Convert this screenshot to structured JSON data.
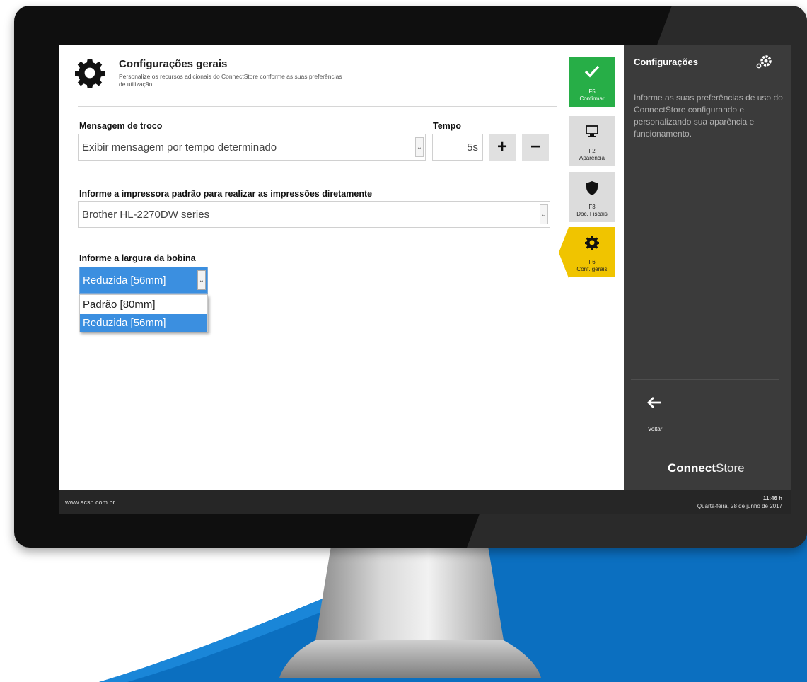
{
  "header": {
    "title": "Configurações gerais",
    "subtitle": "Personalize os recursos adicionais do ConnectStore conforme as suas preferências de utilização."
  },
  "troco": {
    "label": "Mensagem de troco",
    "value": "Exibir mensagem por tempo determinado",
    "tempo_label": "Tempo",
    "tempo_value": "5s",
    "plus": "+",
    "minus": "−"
  },
  "impressora": {
    "label": "Informe a impressora padrão para realizar as impressões diretamente",
    "value": "Brother HL-2270DW series"
  },
  "bobina": {
    "label": "Informe a largura da bobina",
    "value": "Reduzida [56mm]",
    "options": [
      "Padrão [80mm]",
      "Reduzida [56mm]"
    ],
    "selected_index": 1
  },
  "tiles": [
    {
      "code": "F5",
      "label": "Confirmar",
      "icon": "check-icon",
      "color": "#27ae47"
    },
    {
      "code": "F2",
      "label": "Aparência",
      "icon": "monitor-icon",
      "color": "#dcdcdc"
    },
    {
      "code": "F3",
      "label": "Doc. Fiscais",
      "icon": "shield-icon",
      "color": "#dcdcdc"
    },
    {
      "code": "F6",
      "label": "Conf. gerais",
      "icon": "gear-icon",
      "color": "#f0c400"
    }
  ],
  "side": {
    "title": "Configurações",
    "description": "Informe as suas preferências de uso do ConnectStore configurando e personalizando sua aparência e funcionamento.",
    "back_label": "Voltar",
    "brand_bold": "Connect",
    "brand_light": "Store"
  },
  "footer": {
    "url": "www.acsn.com.br",
    "time": "11:46 h",
    "date": "Quarta-feira, 28 de junho de 2017"
  },
  "colors": {
    "accent_blue": "#3b8fe0",
    "panel_dark": "#3b3b3b",
    "confirm_green": "#27ae47",
    "active_yellow": "#f0c400",
    "backdrop_blue": "#0b6fc0"
  }
}
